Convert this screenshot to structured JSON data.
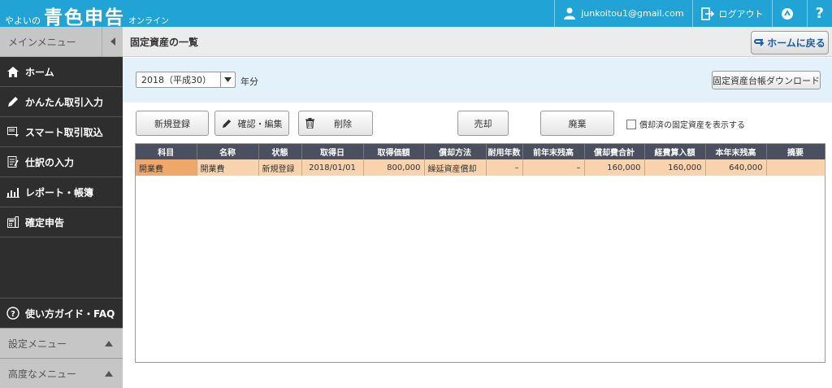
{
  "header": {
    "brand_prefix": "やよいの",
    "brand_main": "青色申告",
    "brand_suffix": "オンライン",
    "user_email": "junkoitou1@gmail.com",
    "logout_label": "ログアウト",
    "help_label": "?"
  },
  "sidebar": {
    "main_menu_label": "メインメニュー",
    "items": [
      {
        "label": "ホーム",
        "icon": "home-icon"
      },
      {
        "label": "かんたん取引入力",
        "icon": "pencil-icon"
      },
      {
        "label": "スマート取引取込",
        "icon": "import-icon"
      },
      {
        "label": "仕訳の入力",
        "icon": "journal-icon"
      },
      {
        "label": "レポート・帳簿",
        "icon": "report-icon"
      },
      {
        "label": "確定申告",
        "icon": "calculator-icon"
      }
    ],
    "guide_label": "使い方ガイド・FAQ",
    "settings_menu_label": "設定メニュー",
    "advanced_menu_label": "高度なメニュー"
  },
  "main": {
    "page_title": "固定資産の一覧",
    "home_button_label": "ホームに戻る",
    "year_select_value": "2018（平成30）",
    "year_suffix": "年分",
    "download_button_label": "固定資産台帳ダウンロード",
    "buttons": {
      "new": "新規登録",
      "edit": "確認・編集",
      "delete": "削除",
      "sell": "売却",
      "dispose": "廃棄"
    },
    "show_depreciated_label": "償却済の固定資産を表示する",
    "show_depreciated_checked": false,
    "table": {
      "columns": [
        "科目",
        "名称",
        "状態",
        "取得日",
        "取得価額",
        "償却方法",
        "耐用年数",
        "前年末残高",
        "償却費合計",
        "経費算入額",
        "本年末残高",
        "摘要"
      ],
      "rows": [
        [
          "開業費",
          "開業費",
          "新規登録",
          "2018/01/01",
          "800,000",
          "繰延資産償却",
          "–",
          "–",
          "160,000",
          "160,000",
          "640,000",
          ""
        ]
      ]
    }
  },
  "colors": {
    "topbar": "#22a3d6",
    "sidebar": "#2e2e2e",
    "table_header": "#4a5060",
    "selected_row": "#f8d3ad",
    "filter_band": "#e3f1fb"
  }
}
